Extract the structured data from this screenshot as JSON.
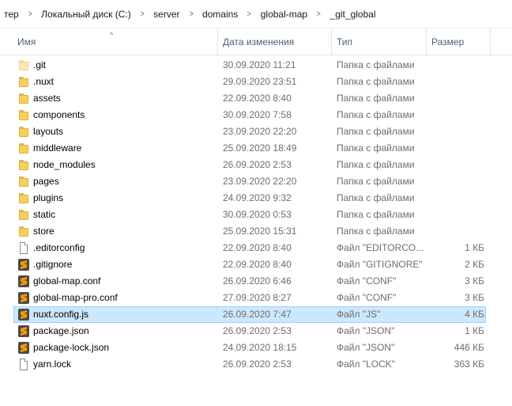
{
  "breadcrumb": [
    "тер",
    "Локальный диск (C:)",
    "server",
    "domains",
    "global-map",
    "_git_global"
  ],
  "columns": {
    "name": "Имя",
    "date": "Дата изменения",
    "type": "Тип",
    "size": "Размер"
  },
  "selected_index": 15,
  "files": [
    {
      "name": ".git",
      "date": "30.09.2020 11:21",
      "type": "Папка с файлами",
      "size": "",
      "icon": "folder-icon-dim"
    },
    {
      "name": ".nuxt",
      "date": "29.09.2020 23:51",
      "type": "Папка с файлами",
      "size": "",
      "icon": "folder-icon"
    },
    {
      "name": "assets",
      "date": "22.09.2020 8:40",
      "type": "Папка с файлами",
      "size": "",
      "icon": "folder-icon"
    },
    {
      "name": "components",
      "date": "30.09.2020 7:58",
      "type": "Папка с файлами",
      "size": "",
      "icon": "folder-icon"
    },
    {
      "name": "layouts",
      "date": "23.09.2020 22:20",
      "type": "Папка с файлами",
      "size": "",
      "icon": "folder-icon"
    },
    {
      "name": "middleware",
      "date": "25.09.2020 18:49",
      "type": "Папка с файлами",
      "size": "",
      "icon": "folder-icon"
    },
    {
      "name": "node_modules",
      "date": "26.09.2020 2:53",
      "type": "Папка с файлами",
      "size": "",
      "icon": "folder-icon"
    },
    {
      "name": "pages",
      "date": "23.09.2020 22:20",
      "type": "Папка с файлами",
      "size": "",
      "icon": "folder-icon"
    },
    {
      "name": "plugins",
      "date": "24.09.2020 9:32",
      "type": "Папка с файлами",
      "size": "",
      "icon": "folder-icon"
    },
    {
      "name": "static",
      "date": "30.09.2020 0:53",
      "type": "Папка с файлами",
      "size": "",
      "icon": "folder-icon"
    },
    {
      "name": "store",
      "date": "25.09.2020 15:31",
      "type": "Папка с файлами",
      "size": "",
      "icon": "folder-icon"
    },
    {
      "name": ".editorconfig",
      "date": "22.09.2020 8:40",
      "type": "Файл \"EDITORCO...",
      "size": "1 КБ",
      "icon": "file-icon"
    },
    {
      "name": ".gitignore",
      "date": "22.09.2020 8:40",
      "type": "Файл \"GITIGNORE\"",
      "size": "2 КБ",
      "icon": "sublime-icon"
    },
    {
      "name": "global-map.conf",
      "date": "26.09.2020 6:46",
      "type": "Файл \"CONF\"",
      "size": "3 КБ",
      "icon": "sublime-icon"
    },
    {
      "name": "global-map-pro.conf",
      "date": "27.09.2020 8:27",
      "type": "Файл \"CONF\"",
      "size": "3 КБ",
      "icon": "sublime-icon"
    },
    {
      "name": "nuxt.config.js",
      "date": "26.09.2020 7:47",
      "type": "Файл \"JS\"",
      "size": "4 КБ",
      "icon": "sublime-icon"
    },
    {
      "name": "package.json",
      "date": "26.09.2020 2:53",
      "type": "Файл \"JSON\"",
      "size": "1 КБ",
      "icon": "sublime-icon"
    },
    {
      "name": "package-lock.json",
      "date": "24.09.2020 18:15",
      "type": "Файл \"JSON\"",
      "size": "446 КБ",
      "icon": "sublime-icon"
    },
    {
      "name": "yarn.lock",
      "date": "26.09.2020 2:53",
      "type": "Файл \"LOCK\"",
      "size": "363 КБ",
      "icon": "file-icon"
    }
  ]
}
